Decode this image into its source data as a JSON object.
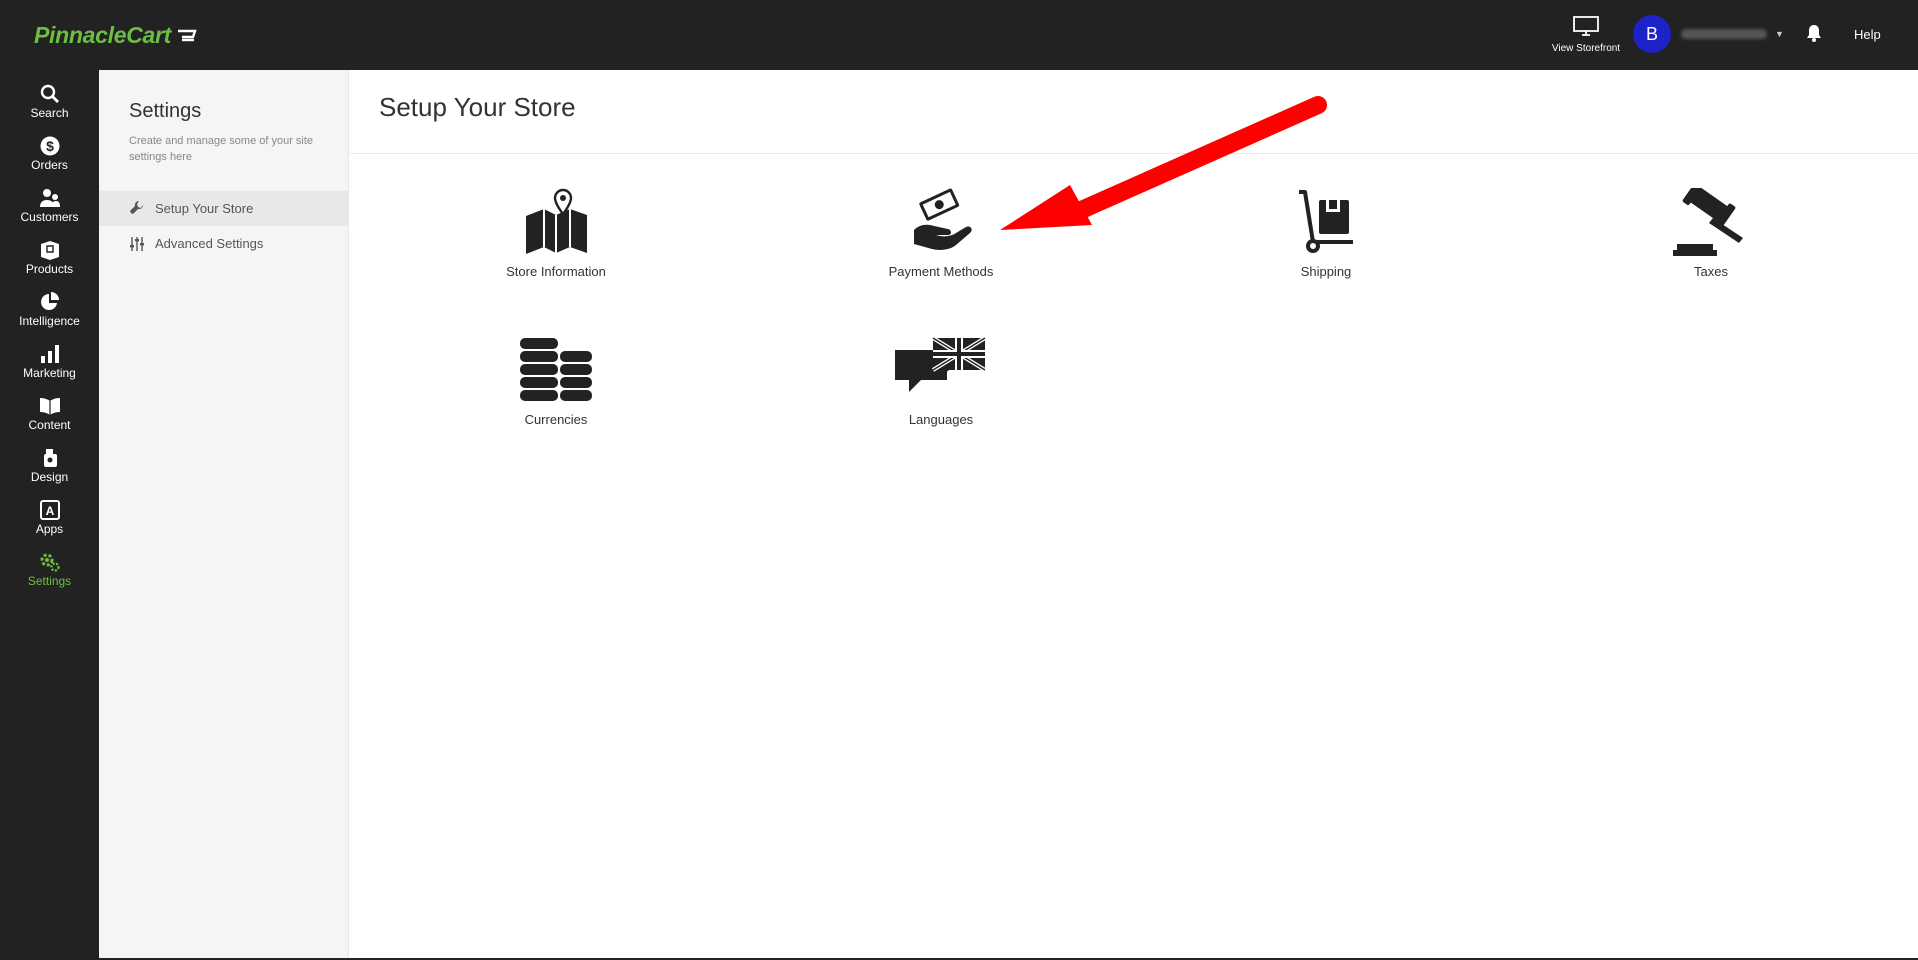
{
  "app": {
    "brand": "PinnacleCart"
  },
  "topbar": {
    "view_storefront": "View Storefront",
    "user_initial": "B",
    "help": "Help"
  },
  "nav": {
    "items": [
      {
        "label": "Search",
        "icon": "search-icon"
      },
      {
        "label": "Orders",
        "icon": "dollar-icon"
      },
      {
        "label": "Customers",
        "icon": "users-icon"
      },
      {
        "label": "Products",
        "icon": "box-icon"
      },
      {
        "label": "Intelligence",
        "icon": "pie-chart-icon"
      },
      {
        "label": "Marketing",
        "icon": "bar-chart-icon"
      },
      {
        "label": "Content",
        "icon": "book-icon"
      },
      {
        "label": "Design",
        "icon": "paint-icon"
      },
      {
        "label": "Apps",
        "icon": "apps-icon"
      },
      {
        "label": "Settings",
        "icon": "gears-icon",
        "active": true
      }
    ]
  },
  "sidebar": {
    "title": "Settings",
    "description": "Create and manage some of your site settings here",
    "items": [
      {
        "label": "Setup Your Store",
        "icon": "wrench-icon",
        "active": true
      },
      {
        "label": "Advanced Settings",
        "icon": "sliders-icon"
      }
    ]
  },
  "main": {
    "title": "Setup Your Store",
    "tiles": [
      {
        "label": "Store Information",
        "icon": "map-icon"
      },
      {
        "label": "Payment Methods",
        "icon": "money-hand-icon"
      },
      {
        "label": "Shipping",
        "icon": "hand-truck-icon"
      },
      {
        "label": "Taxes",
        "icon": "gavel-icon"
      },
      {
        "label": "Currencies",
        "icon": "coins-icon"
      },
      {
        "label": "Languages",
        "icon": "language-flag-icon"
      }
    ]
  },
  "colors": {
    "brand_green": "#6dbe45",
    "dark_bar": "#222222",
    "avatar_blue": "#1d23c8",
    "annotation_red": "#ff0000"
  }
}
